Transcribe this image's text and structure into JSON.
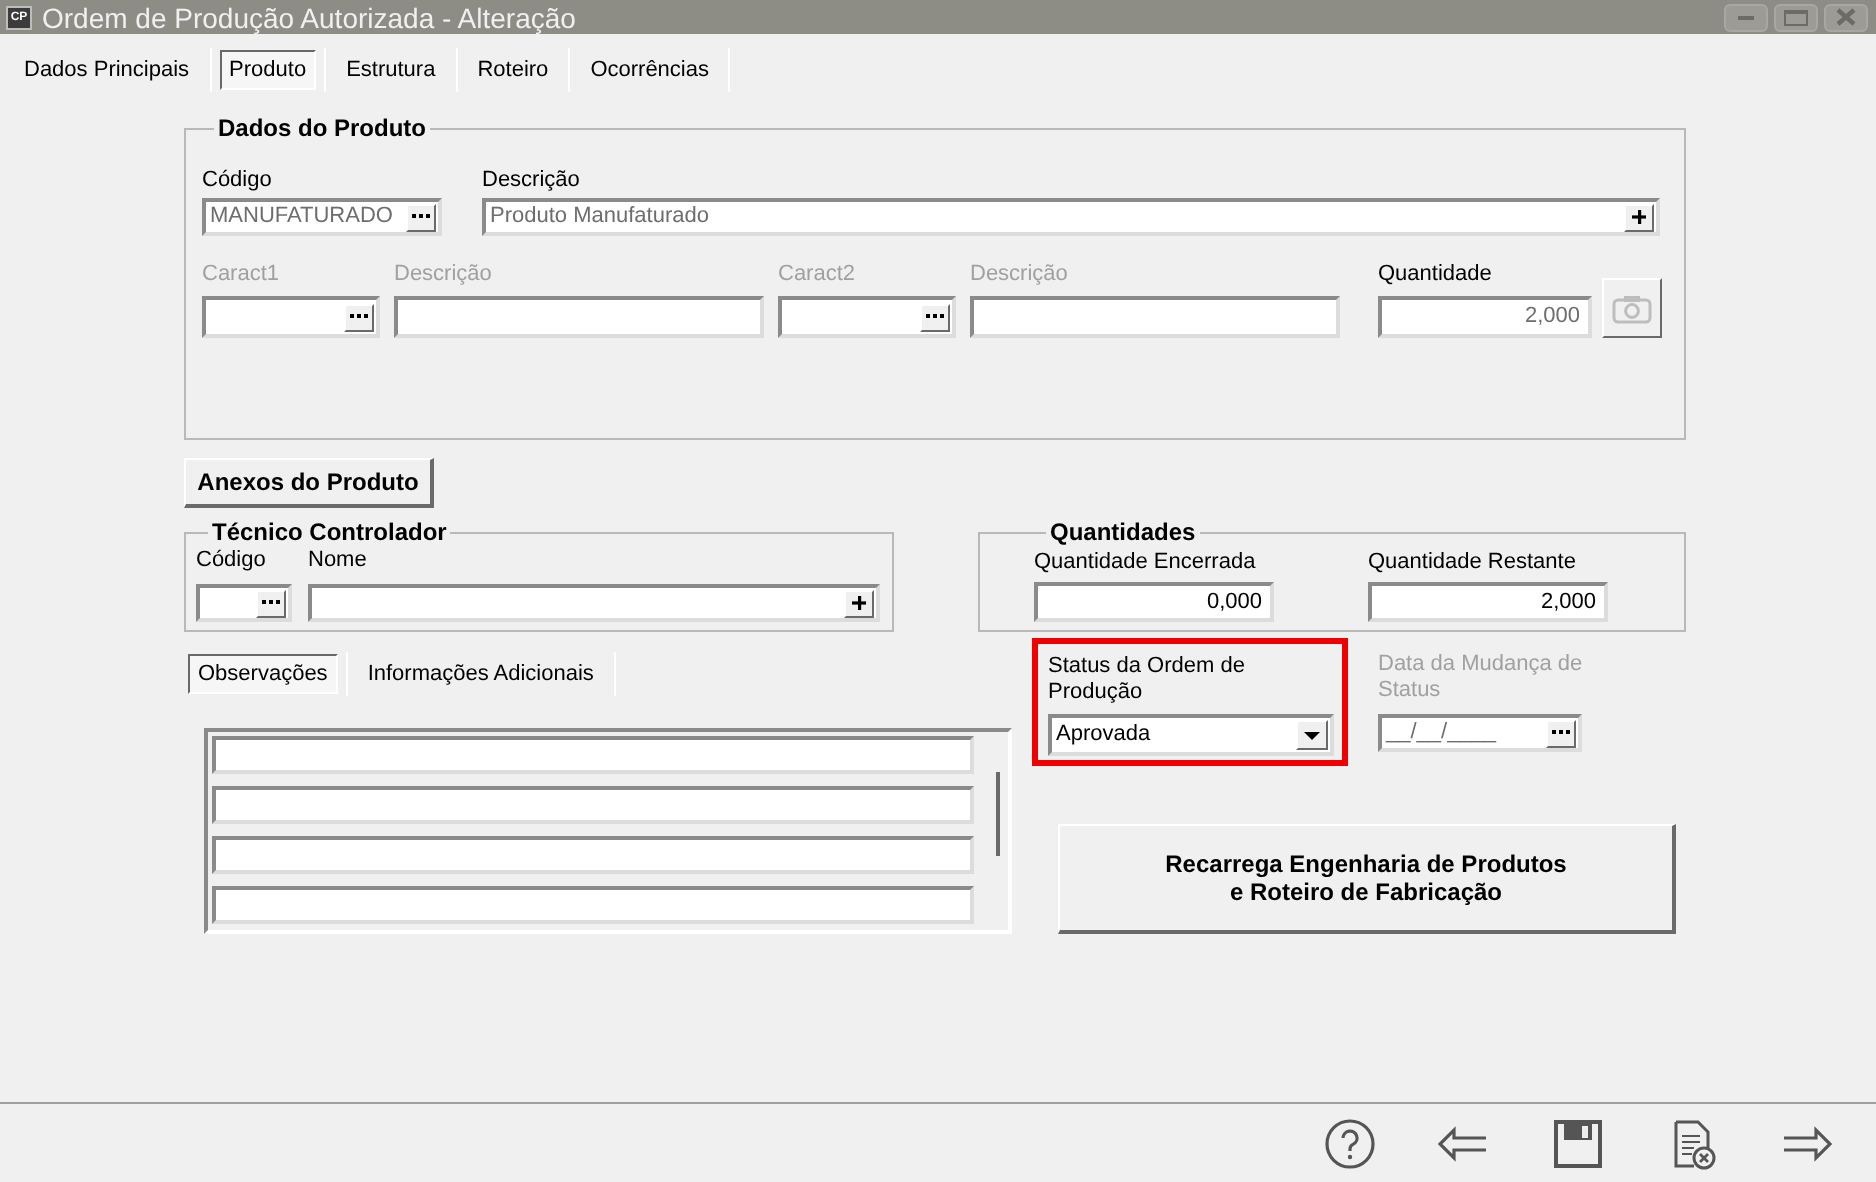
{
  "window": {
    "title": "Ordem de Produção Autorizada - Alteração",
    "icon_text": "CP"
  },
  "tabs": [
    {
      "label": "Dados Principais",
      "selected": false
    },
    {
      "label": "Produto",
      "selected": true
    },
    {
      "label": "Estrutura",
      "selected": false
    },
    {
      "label": "Roteiro",
      "selected": false
    },
    {
      "label": "Ocorrências",
      "selected": false
    }
  ],
  "product": {
    "title": "Dados do Produto",
    "code": {
      "label": "Código",
      "value": "MANUFATURADO"
    },
    "description": {
      "label": "Descrição",
      "value": "Produto Manufaturado"
    },
    "caract1": {
      "label": "Caract1",
      "disabled": true
    },
    "caract1_description": {
      "label": "Descrição",
      "disabled": true
    },
    "caract2": {
      "label": "Caract2",
      "disabled": true
    },
    "caract2_description": {
      "label": "Descrição",
      "disabled": true
    },
    "quantity": {
      "label": "Quantidade",
      "value": "2,000"
    },
    "camera_button": {
      "disabled": true
    }
  },
  "attachments_button": "Anexos do Produto",
  "technician": {
    "title": "Técnico Controlador",
    "code_label": "Código",
    "name_label": "Nome"
  },
  "quantities": {
    "title": "Quantidades",
    "fields": [
      {
        "label": "Quantidade Encerrada",
        "value": "0,000"
      },
      {
        "label": "Quantidade Restante",
        "value": "2,000"
      }
    ]
  },
  "notes_tabs": [
    {
      "label": "Observações",
      "selected": true
    },
    {
      "label": "Informações Adicionais",
      "selected": false
    }
  ],
  "status": {
    "label": "Status da Ordem de Produção",
    "value": "Aprovada",
    "highlighted": true
  },
  "status_date": {
    "label": "Data da Mudança de Status",
    "value": "__/__/____",
    "disabled": true
  },
  "reload_button": {
    "lines": [
      "Recarrega Engenharia de Produtos",
      "e Roteiro de Fabricação"
    ]
  }
}
